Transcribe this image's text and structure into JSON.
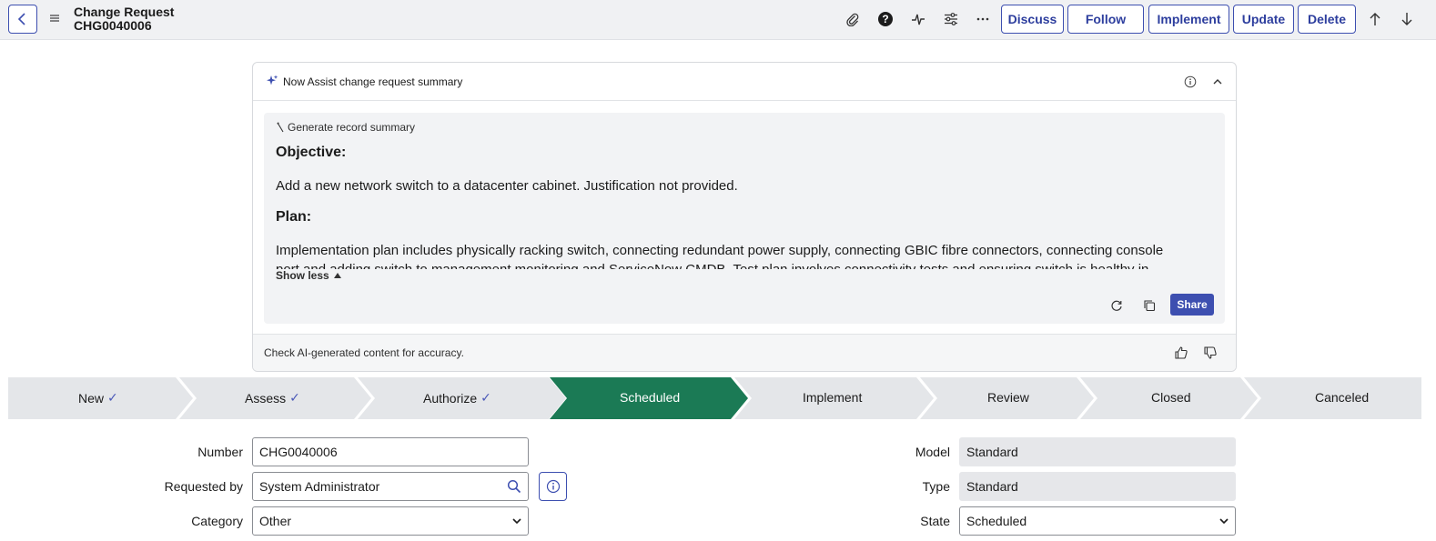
{
  "header": {
    "title": "Change Request",
    "record_number": "CHG0040006",
    "icons": [
      "back-icon",
      "menu-icon",
      "paperclip-icon",
      "help-icon",
      "activity-icon",
      "settings-sliders-icon",
      "more-icon",
      "arrow-up-icon",
      "arrow-down-icon"
    ],
    "buttons": {
      "discuss": "Discuss",
      "follow": "Follow",
      "implement": "Implement",
      "update": "Update",
      "delete": "Delete"
    }
  },
  "assist": {
    "title": "Now Assist change request summary",
    "generate_label": "Generate record summary",
    "objective_heading": "Objective:",
    "objective_text": "Add a new network switch to a datacenter cabinet. Justification not provided.",
    "plan_heading": "Plan:",
    "plan_text": "Implementation plan includes physically racking switch, connecting redundant power supply, connecting GBIC fibre connectors, connecting console",
    "plan_text_cont": "port and adding switch to management monitoring and ServiceNow CMDB. Test plan involves connectivity tests and ensuring switch is healthy in",
    "show_less": "Show less",
    "share": "Share",
    "footer": "Check AI-generated content for accuracy."
  },
  "stages": [
    {
      "label": "New",
      "done": true,
      "active": false
    },
    {
      "label": "Assess",
      "done": true,
      "active": false
    },
    {
      "label": "Authorize",
      "done": true,
      "active": false
    },
    {
      "label": "Scheduled",
      "done": false,
      "active": true
    },
    {
      "label": "Implement",
      "done": false,
      "active": false
    },
    {
      "label": "Review",
      "done": false,
      "active": false
    },
    {
      "label": "Closed",
      "done": false,
      "active": false
    },
    {
      "label": "Canceled",
      "done": false,
      "active": false
    }
  ],
  "stage_check": "✓",
  "form": {
    "number_label": "Number",
    "number_value": "CHG0040006",
    "requested_by_label": "Requested by",
    "requested_by_value": "System Administrator",
    "category_label": "Category",
    "category_value": "Other",
    "model_label": "Model",
    "model_value": "Standard",
    "type_label": "Type",
    "type_value": "Standard",
    "state_label": "State",
    "state_value": "Scheduled"
  },
  "colors": {
    "accent": "#3d4fb0",
    "stage_active": "#1b7a55",
    "stage_inactive": "#e4e6e9",
    "topbar": "#f0f1f3"
  }
}
